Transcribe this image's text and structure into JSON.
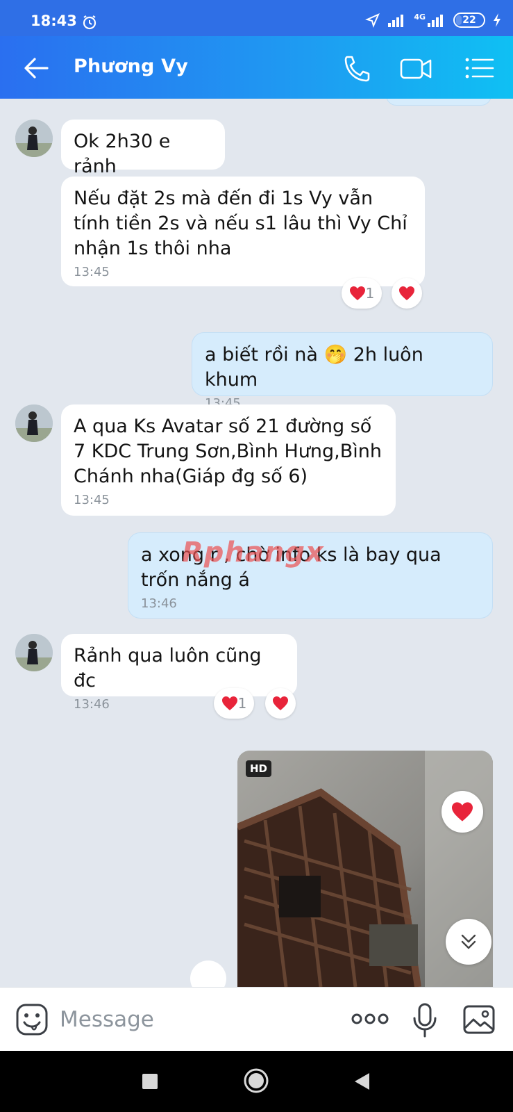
{
  "status_bar": {
    "time": "18:43",
    "network": "4G",
    "battery": "22"
  },
  "header": {
    "title": "Phương Vy"
  },
  "messages": [
    {
      "direction": "in",
      "text": "Ok 2h30 e rảnh"
    },
    {
      "direction": "in",
      "text": "Nếu đặt 2s mà đến đi 1s Vy vẫn tính tiền 2s và nếu s1 lâu thì Vy Chỉ nhận 1s thôi nha",
      "time": "13:45",
      "reaction_count": "1"
    },
    {
      "direction": "out",
      "text": "a biết rồi nà 🤭 2h luôn khum",
      "time": "13:45"
    },
    {
      "direction": "in",
      "text": "A qua Ks Avatar số 21 đường số 7 KDC Trung Sơn,Bình Hưng,Bình Chánh nha(Giáp đg số 6)",
      "time": "13:45"
    },
    {
      "direction": "out",
      "text": "a xong r , chờ info ks là bay qua trốn nắng á",
      "time": "13:46"
    },
    {
      "direction": "in",
      "text": "Rảnh qua luôn cũng đc",
      "time": "13:46",
      "reaction_count": "1"
    }
  ],
  "photo": {
    "badge": "HD"
  },
  "watermark": "Rphangx",
  "input": {
    "placeholder": "Message"
  },
  "colors": {
    "header_start": "#2a6ff0",
    "header_end": "#0fc0f3",
    "outgoing_bubble": "#d6ecfc",
    "incoming_bubble": "#ffffff",
    "chat_background": "#e2e7ee",
    "heart": "#e8243a"
  },
  "icons": [
    "alarm-icon",
    "location-icon",
    "signal-icon",
    "charging-icon",
    "back-arrow-icon",
    "phone-icon",
    "video-call-icon",
    "menu-list-icon",
    "heart-icon",
    "chevron-double-down-icon",
    "sticker-icon",
    "more-dots-icon",
    "microphone-icon",
    "image-icon",
    "nav-recents-icon",
    "nav-home-icon",
    "nav-back-icon"
  ]
}
